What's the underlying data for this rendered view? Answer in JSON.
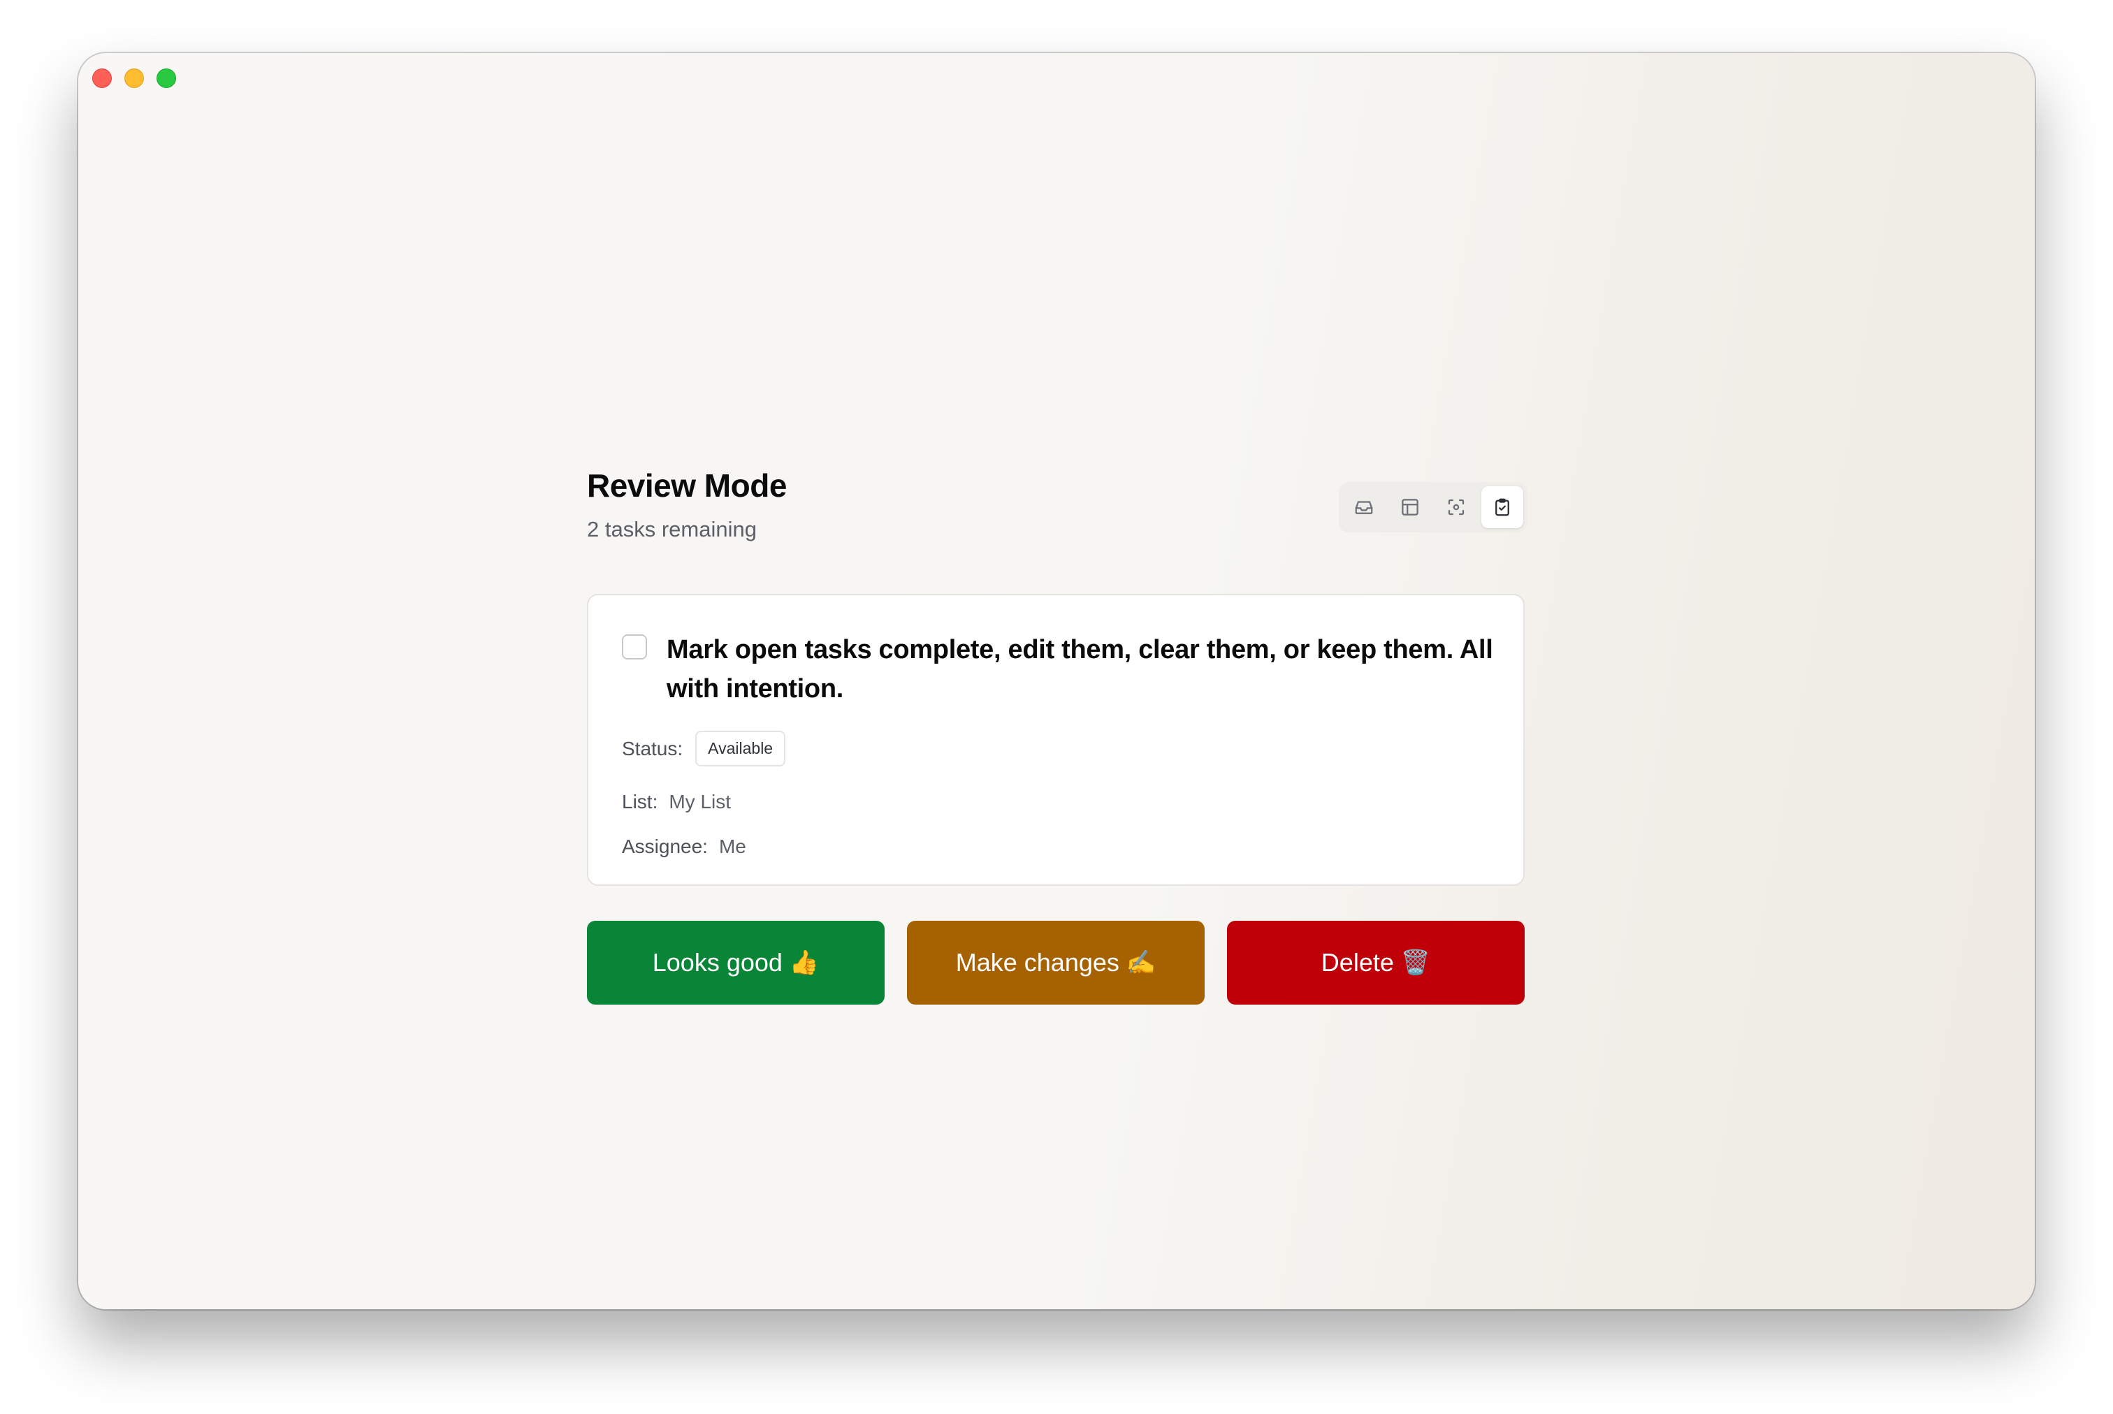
{
  "header": {
    "title": "Review Mode",
    "subtitle": "2 tasks remaining"
  },
  "view_switcher": {
    "icons": [
      "inbox-icon",
      "layout-icon",
      "focus-icon",
      "clipboard-check-icon"
    ],
    "active": "clipboard-check-icon"
  },
  "task": {
    "title": "Mark open tasks complete, edit them, clear them, or keep them. All with intention.",
    "checked": false,
    "status_label": "Status:",
    "status_value": "Available",
    "list_label": "List:",
    "list_value": "My List",
    "assignee_label": "Assignee:",
    "assignee_value": "Me"
  },
  "actions": {
    "good_label": "Looks good",
    "good_emoji": "👍",
    "change_label": "Make changes",
    "change_emoji": "✍️",
    "delete_label": "Delete",
    "delete_emoji": "🗑️"
  },
  "colors": {
    "good": "#088537",
    "change": "#a66200",
    "delete": "#c00008"
  }
}
